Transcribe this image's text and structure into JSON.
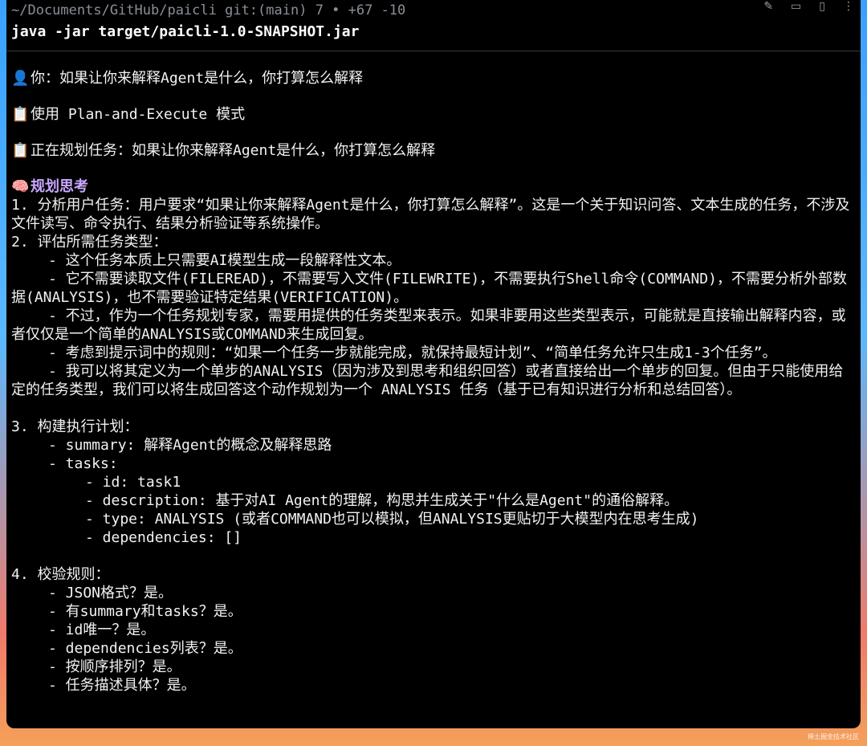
{
  "terminal": {
    "prompt": "~/Documents/GitHub/paicli git:(main) 7 • +67 -10",
    "command": "java -jar target/paicli-1.0-SNAPSHOT.jar",
    "toolbar_icons": [
      "pen-icon",
      "folder-icon",
      "battery-icon",
      "more-icon"
    ]
  },
  "messages": {
    "user": "你：如果让你来解释Agent是什么，你打算怎么解释",
    "mode": "使用 Plan-and-Execute 模式",
    "planning": "正在规划任务：如果让你来解释Agent是什么，你打算怎么解释",
    "think_heading": "规划思考"
  },
  "thinking": {
    "step1": "1. 分析用户任务：用户要求“如果让你来解释Agent是什么，你打算怎么解释”。这是一个关于知识问答、文本生成的任务，不涉及文件读写、命令执行、结果分析验证等系统操作。",
    "step2_title": "2. 评估所需任务类型：",
    "step2_items": [
      "- 这个任务本质上只需要AI模型生成一段解释性文本。",
      "- 它不需要读取文件(FILEREAD)，不需要写入文件(FILEWRITE)，不需要执行Shell命令(COMMAND)，不需要分析外部数据(ANALYSIS)，也不需要验证特定结果(VERIFICATION)。",
      "- 不过，作为一个任务规划专家，需要用提供的任务类型来表示。如果非要用这些类型表示，可能就是直接输出解释内容，或者仅仅是一个简单的ANALYSIS或COMMAND来生成回复。",
      "- 考虑到提示词中的规则：“如果一个任务一步就能完成，就保持最短计划”、“简单任务允许只生成1-3个任务”。",
      "- 我可以将其定义为一个单步的ANALYSIS（因为涉及到思考和组织回答）或者直接给出一个单步的回复。但由于只能使用给定的任务类型，我们可以将生成回答这个动作规划为一个 ANALYSIS 任务（基于已有知识进行分析和总结回答）。"
    ],
    "step3_title": "3. 构建执行计划：",
    "step3_summary": "- summary: 解释Agent的概念及解释思路",
    "step3_tasks": "- tasks:",
    "step3_task_fields": [
      "- id: task1",
      "- description: 基于对AI Agent的理解，构思并生成关于\"什么是Agent\"的通俗解释。",
      "- type: ANALYSIS (或者COMMAND也可以模拟，但ANALYSIS更贴切于大模型内在思考生成)",
      "- dependencies: []"
    ],
    "step4_title": "4. 校验规则：",
    "step4_items": [
      "- JSON格式？是。",
      "- 有summary和tasks？是。",
      "- id唯一？是。",
      "- dependencies列表？是。",
      "- 按顺序排列？是。",
      "- 任务描述具体？是。"
    ]
  },
  "watermark": "稀土掘金技术社区"
}
